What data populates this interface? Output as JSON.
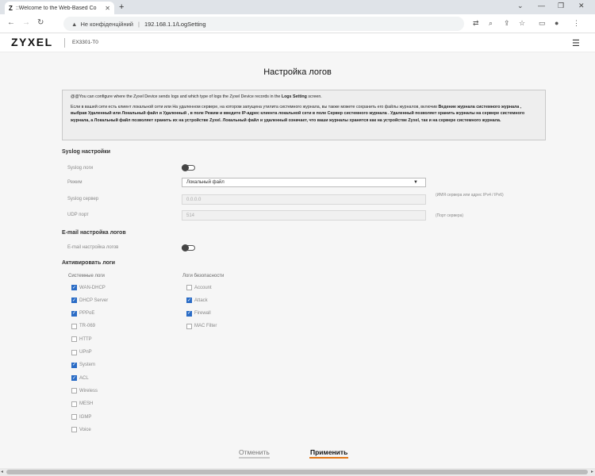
{
  "browser": {
    "tab_favicon": "Z",
    "tab_title": "::Welcome to the Web-Based Co",
    "tab_close": "✕",
    "new_tab": "+",
    "security_label": "Не конфіденційний",
    "url": "192.168.1.1/LogSetting"
  },
  "header": {
    "logo": "ZYXEL",
    "model": "EX3301-T0"
  },
  "page": {
    "title": "Настройка логов",
    "info_line1_a": "@@You can configure where the Zyxel Device sends logs and which type of logs the Zyxel Device records in the ",
    "info_line1_b": "Logs Setting",
    "info_line1_c": " screen.",
    "info_p2_a": "Если в вашей сети есть клиент локальной сети или На удаленном сервере, на котором запущена утилита системного журнала, вы также можете сохранить его файлы журналов, включив ",
    "info_p2_b": "Ведение журнала системного журнала , выбрав Удаленный или Локальный файл и Удаленный , в поле Режим и введите IP-адрес клиента локальной сети в поле Сервер системного журнала . Удаленный позволяет хранить журналы на сервере системного журнала, а Локальный файл позволяет хранить их на устройстве Zyxel. Локальный файл и удаленный означает, что ваши журналы хранятся как на устройстве Zyxel, так и на сервере системного журнала."
  },
  "syslog": {
    "section_title": "Syslog настройки",
    "syslog_label": "Syslog логи",
    "mode_label": "Режим",
    "mode_value": "Локальный файл",
    "server_label": "Syslog сервер",
    "server_placeholder": "0.0.0.0",
    "server_hint": "(ИМЯ сервера или адрес IPv4 / IPv6)",
    "port_label": "UDP порт",
    "port_placeholder": "514",
    "port_hint": "(Порт сервера)"
  },
  "email": {
    "section_title": "E-mail настройка логов",
    "toggle_label": "E-mail настройка логов"
  },
  "activate": {
    "section_title": "Активировать логи",
    "system_col_title": "Системные логи",
    "security_col_title": "Логи безопасности",
    "system_logs": [
      {
        "label": "WAN-DHCP",
        "checked": true
      },
      {
        "label": "DHCP Server",
        "checked": true
      },
      {
        "label": "PPPoE",
        "checked": true
      },
      {
        "label": "TR-069",
        "checked": false
      },
      {
        "label": "HTTP",
        "checked": false
      },
      {
        "label": "UPnP",
        "checked": false
      },
      {
        "label": "System",
        "checked": true
      },
      {
        "label": "ACL",
        "checked": true
      },
      {
        "label": "Wireless",
        "checked": false
      },
      {
        "label": "MESH",
        "checked": false
      },
      {
        "label": "IGMP",
        "checked": false
      },
      {
        "label": "Voice",
        "checked": false
      }
    ],
    "security_logs": [
      {
        "label": "Account",
        "checked": false
      },
      {
        "label": "Attack",
        "checked": true
      },
      {
        "label": "Firewall",
        "checked": true
      },
      {
        "label": "MAC Filter",
        "checked": false
      }
    ]
  },
  "buttons": {
    "cancel": "Отменить",
    "apply": "Применить"
  },
  "colors": {
    "accent": "#e27817",
    "checkbox": "#2a6cc6"
  }
}
